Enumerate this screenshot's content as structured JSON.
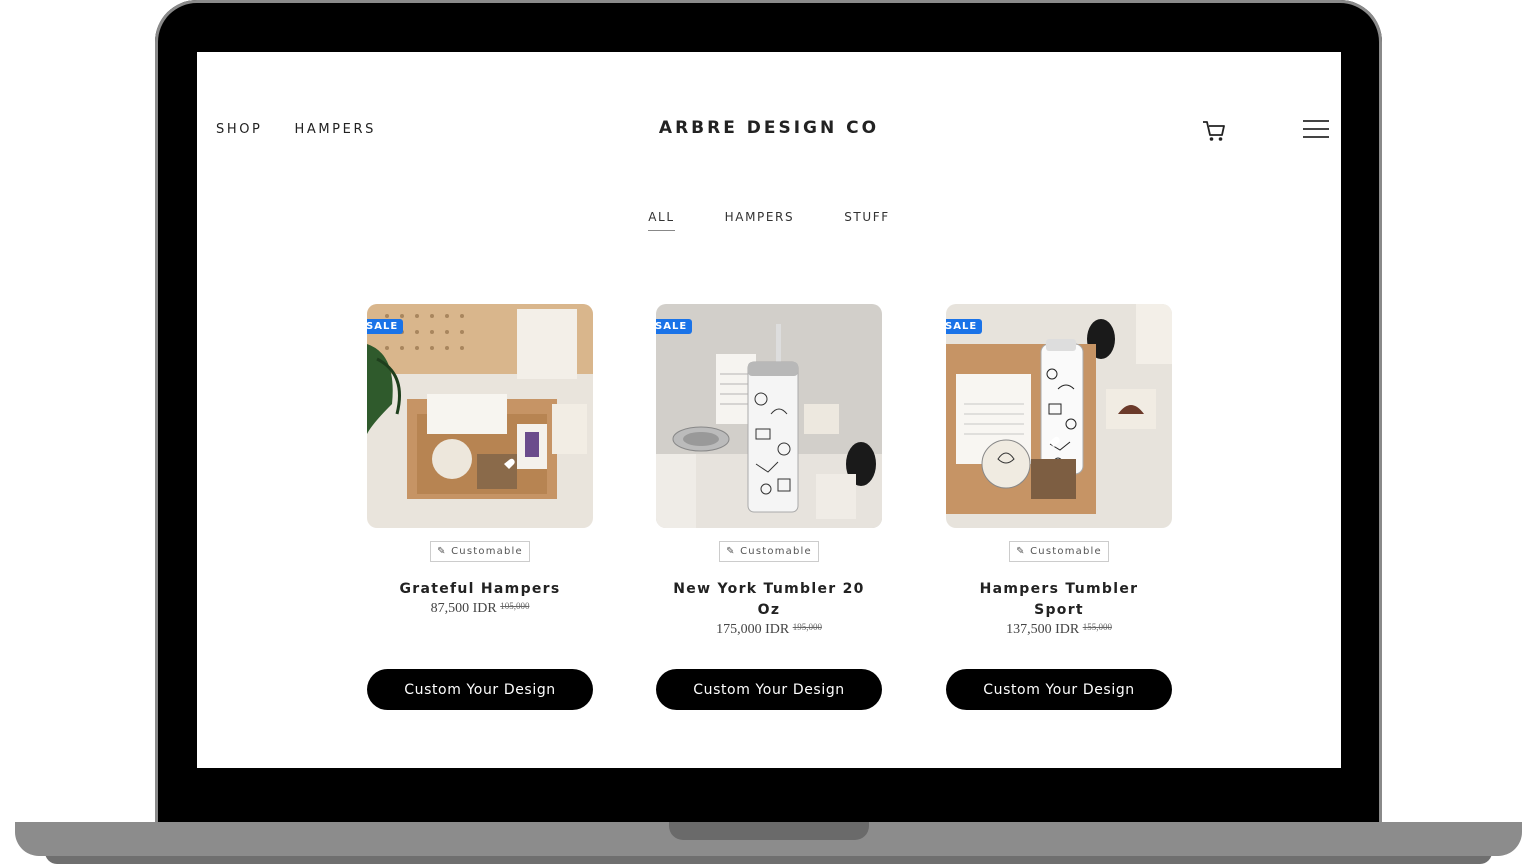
{
  "header": {
    "nav": [
      "SHOP",
      "HAMPERS"
    ],
    "brand": "ARBRE DESIGN CO",
    "cart_icon": "cart-icon",
    "menu_icon": "hamburger-menu-icon"
  },
  "filters": [
    {
      "label": "ALL",
      "active": true
    },
    {
      "label": "HAMPERS",
      "active": false
    },
    {
      "label": "STUFF",
      "active": false
    }
  ],
  "products": [
    {
      "badge": "SALE",
      "tag": "Customable",
      "name": "Grateful Hampers",
      "price": "87,500 IDR",
      "old_price": "105,000",
      "cta": "Custom Your Design"
    },
    {
      "badge": "SALE",
      "tag": "Customable",
      "name": "New York Tumbler 20 Oz",
      "price": "175,000 IDR",
      "old_price": "195,000",
      "cta": "Custom Your Design"
    },
    {
      "badge": "SALE",
      "tag": "Customable",
      "name": "Hampers Tumbler Sport",
      "price": "137,500 IDR",
      "old_price": "155,000",
      "cta": "Custom Your Design"
    }
  ],
  "colors": {
    "sale_badge": "#1a73e8",
    "button": "#000000",
    "frame": "#000000"
  }
}
